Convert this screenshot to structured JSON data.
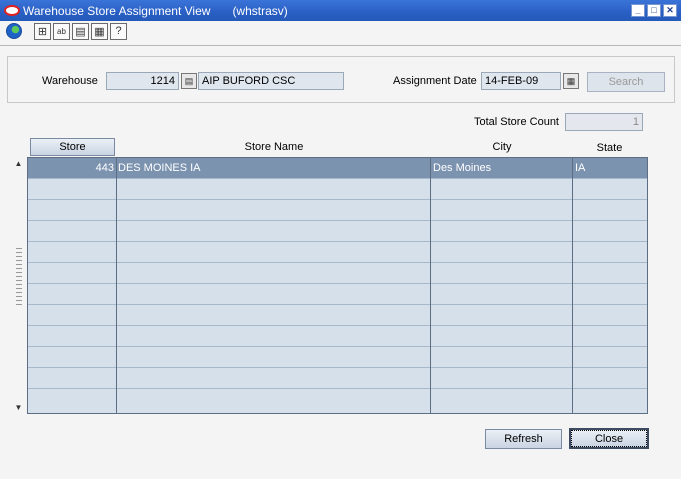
{
  "window": {
    "title": "Warehouse Store Assignment View",
    "code": "(whstrasv)"
  },
  "toolbar": {
    "buttons": [
      "globe-icon",
      "calculator-icon",
      "abc-icon",
      "clipboard-icon",
      "print-icon",
      "help-icon"
    ]
  },
  "filter": {
    "warehouse_label": "Warehouse",
    "warehouse_id": "1214",
    "warehouse_name": "AIP BUFORD CSC",
    "assignment_date_label": "Assignment Date",
    "assignment_date": "14-FEB-09",
    "search_label": "Search"
  },
  "summary": {
    "total_store_count_label": "Total Store Count",
    "total_store_count": "1"
  },
  "table": {
    "columns": [
      "Store",
      "Store Name",
      "City",
      "State"
    ],
    "rows": [
      {
        "store": "443",
        "store_name": "DES MOINES IA",
        "city": "Des Moines",
        "state": "IA"
      }
    ]
  },
  "footer": {
    "refresh_label": "Refresh",
    "close_label": "Close"
  },
  "colors": {
    "titlebar": "#2a5fc4",
    "selected_row": "#7c93b0",
    "grid_bg": "#d6e0ea"
  }
}
